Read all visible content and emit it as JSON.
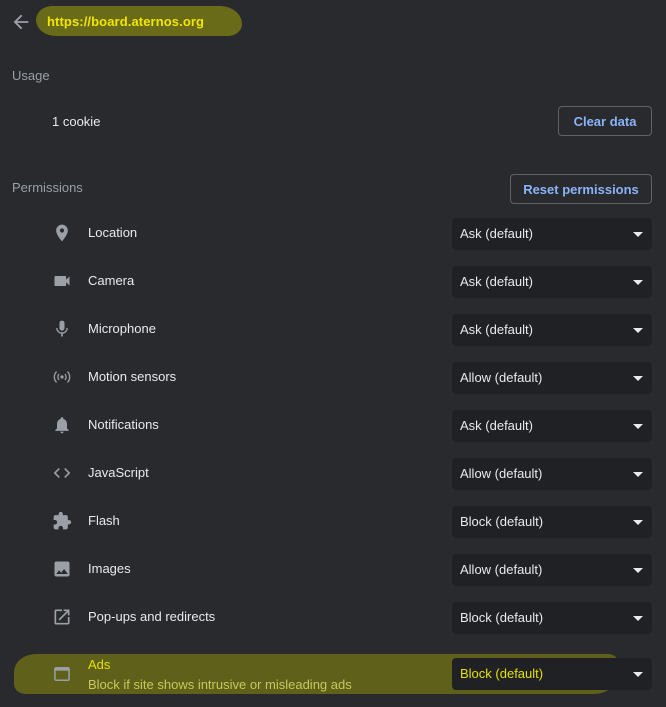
{
  "header": {
    "url": "https://board.aternos.org"
  },
  "usage": {
    "title": "Usage",
    "cookies": "1 cookie",
    "clear_label": "Clear data"
  },
  "permissions": {
    "title": "Permissions",
    "reset_label": "Reset permissions",
    "items": [
      {
        "label": "Location",
        "value": "Ask (default)",
        "icon": "location-icon"
      },
      {
        "label": "Camera",
        "value": "Ask (default)",
        "icon": "camera-icon"
      },
      {
        "label": "Microphone",
        "value": "Ask (default)",
        "icon": "microphone-icon"
      },
      {
        "label": "Motion sensors",
        "value": "Allow (default)",
        "icon": "sensors-icon"
      },
      {
        "label": "Notifications",
        "value": "Ask (default)",
        "icon": "bell-icon"
      },
      {
        "label": "JavaScript",
        "value": "Allow (default)",
        "icon": "code-icon"
      },
      {
        "label": "Flash",
        "value": "Block (default)",
        "icon": "puzzle-icon"
      },
      {
        "label": "Images",
        "value": "Allow (default)",
        "icon": "image-icon"
      },
      {
        "label": "Pop-ups and redirects",
        "value": "Block (default)",
        "icon": "external-link-icon"
      },
      {
        "label": "Ads",
        "sublabel": "Block if site shows intrusive or misleading ads",
        "value": "Block (default)",
        "icon": "window-icon"
      }
    ]
  },
  "colors": {
    "background": "#292a2d",
    "select_bg": "#202124",
    "accent": "#8ab4f8",
    "highlight": "#f2e600"
  }
}
